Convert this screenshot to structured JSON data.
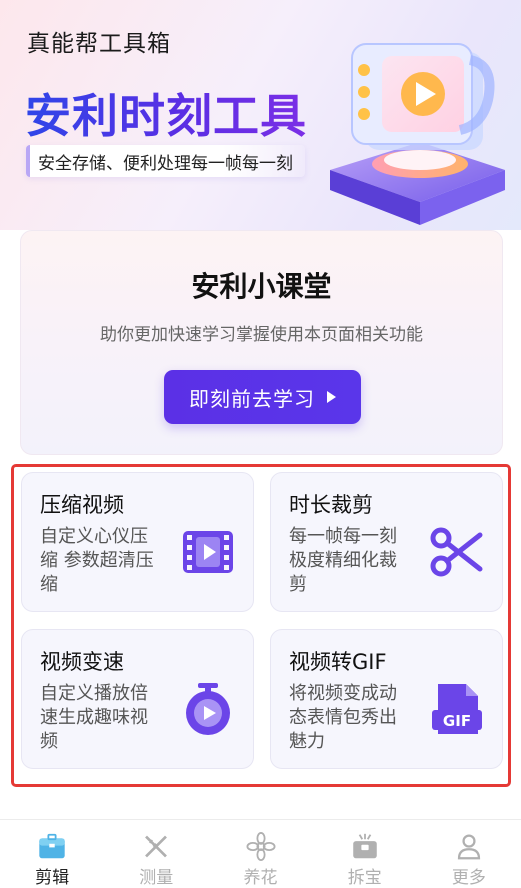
{
  "header": {
    "app_title": "真能帮工具箱",
    "hero_title": "安利时刻工具",
    "hero_subtitle": "安全存储、便利处理每一帧每一刻"
  },
  "course": {
    "title": "安利小课堂",
    "description": "助你更加快速学习掌握使用本页面相关功能",
    "button_label": "即刻前去学习"
  },
  "tools": [
    {
      "title": "压缩视频",
      "description": "自定义心仪压缩 参数超清压缩",
      "icon": "video-film-icon"
    },
    {
      "title": "时长裁剪",
      "description": "每一帧每一刻极度精细化裁剪",
      "icon": "scissors-icon"
    },
    {
      "title": "视频变速",
      "description": "自定义播放倍速生成趣味视频",
      "icon": "stopwatch-icon"
    },
    {
      "title": "视频转GIF",
      "description": "将视频变成动态表情包秀出魅力",
      "icon": "gif-file-icon",
      "gif_text": "GIF"
    }
  ],
  "tabbar": [
    {
      "label": "剪辑",
      "icon": "toolbox-icon",
      "active": true
    },
    {
      "label": "测量",
      "icon": "ruler-pencil-icon",
      "active": false
    },
    {
      "label": "养花",
      "icon": "flower-icon",
      "active": false
    },
    {
      "label": "拆宝",
      "icon": "gift-box-icon",
      "active": false
    },
    {
      "label": "更多",
      "icon": "person-icon",
      "active": false
    }
  ],
  "colors": {
    "accent": "#5b30e6",
    "highlight_border": "#e53935",
    "card_bg": "#f6f6fd",
    "tab_active": "#222222",
    "tab_inactive": "#b0b0b0"
  }
}
